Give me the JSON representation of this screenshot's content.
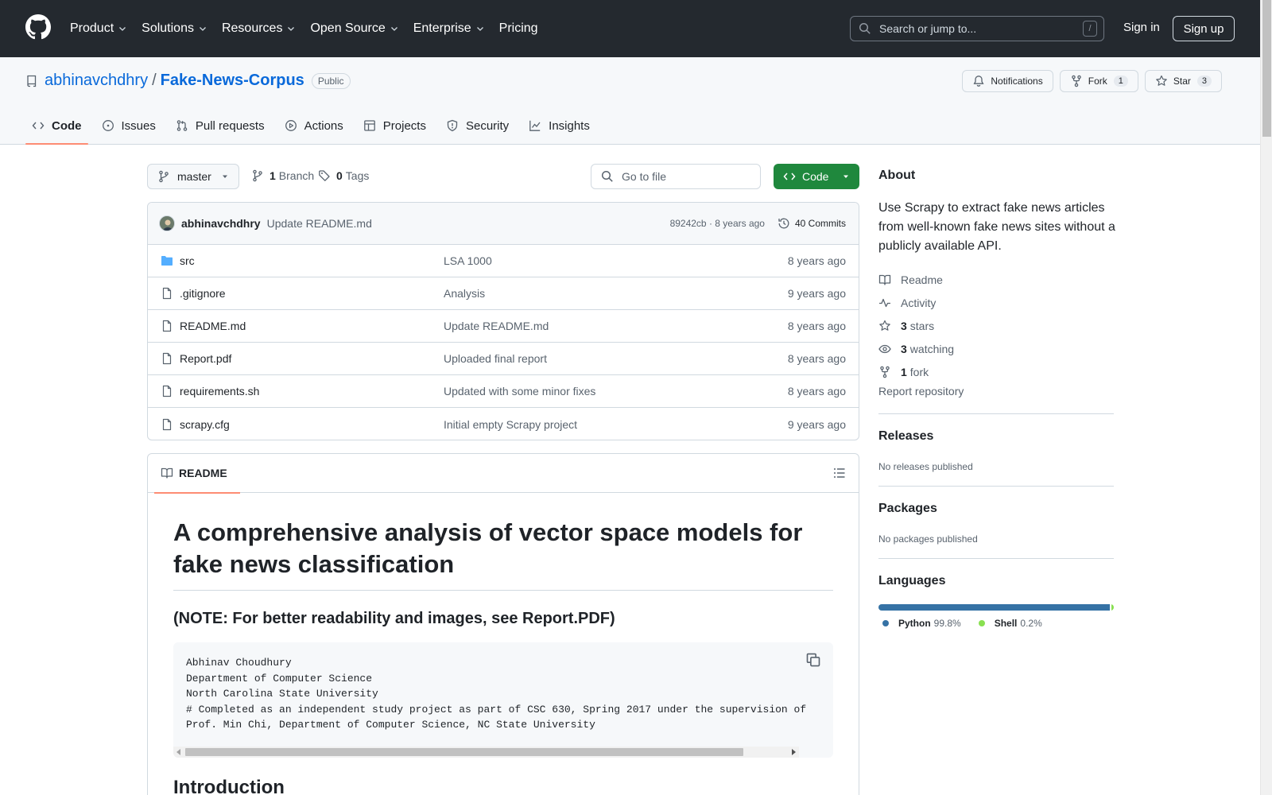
{
  "header": {
    "nav": [
      {
        "label": "Product"
      },
      {
        "label": "Solutions"
      },
      {
        "label": "Resources"
      },
      {
        "label": "Open Source"
      },
      {
        "label": "Enterprise"
      },
      {
        "label": "Pricing"
      }
    ],
    "search_placeholder": "Search or jump to...",
    "search_shortcut": "/",
    "sign_in": "Sign in",
    "sign_up": "Sign up"
  },
  "repo": {
    "owner": "abhinavchdhry",
    "separator": "/",
    "name": "Fake-News-Corpus",
    "visibility": "Public",
    "notifications_label": "Notifications",
    "fork_label": "Fork",
    "fork_count": "1",
    "star_label": "Star",
    "star_count": "3",
    "tabs": [
      {
        "label": "Code",
        "icon": "code-icon"
      },
      {
        "label": "Issues",
        "icon": "issue-icon"
      },
      {
        "label": "Pull requests",
        "icon": "pull-request-icon"
      },
      {
        "label": "Actions",
        "icon": "play-icon"
      },
      {
        "label": "Projects",
        "icon": "table-icon"
      },
      {
        "label": "Security",
        "icon": "shield-icon"
      },
      {
        "label": "Insights",
        "icon": "graph-icon"
      }
    ]
  },
  "toolbar": {
    "branch": "master",
    "branch_count": "1",
    "branch_label": "Branch",
    "tag_count": "0",
    "tag_label": "Tags",
    "goto_placeholder": "Go to file",
    "code_button": "Code"
  },
  "latest_commit": {
    "author": "abhinavchdhry",
    "message": "Update README.md",
    "meta": "89242cb · 8 years ago",
    "commits_label": "40 Commits"
  },
  "files": [
    {
      "name": "src",
      "type": "folder",
      "message": "LSA 1000",
      "date": "8 years ago"
    },
    {
      "name": ".gitignore",
      "type": "file",
      "message": "Analysis",
      "date": "9 years ago"
    },
    {
      "name": "README.md",
      "type": "file",
      "message": "Update README.md",
      "date": "8 years ago"
    },
    {
      "name": "Report.pdf",
      "type": "file",
      "message": "Uploaded final report",
      "date": "8 years ago"
    },
    {
      "name": "requirements.sh",
      "type": "file",
      "message": "Updated with some minor fixes",
      "date": "8 years ago"
    },
    {
      "name": "scrapy.cfg",
      "type": "file",
      "message": "Initial empty Scrapy project",
      "date": "9 years ago"
    }
  ],
  "readme": {
    "tab_label": "README",
    "title": "A comprehensive analysis of vector space models for fake news classification",
    "note": "(NOTE: For better readability and images, see Report.PDF)",
    "code_lines": [
      "Abhinav Choudhury",
      "Department of Computer Science",
      "North Carolina State University",
      "# Completed as an independent study project as part of CSC 630, Spring 2017 under the supervision of",
      "Prof. Min Chi, Department of Computer Science, NC State University"
    ],
    "next_heading": "Introduction"
  },
  "about": {
    "title": "About",
    "description": "Use Scrapy to extract fake news articles from well-known fake news sites without a publicly available API.",
    "items": [
      {
        "icon": "book-icon",
        "bold": "",
        "label": "Readme"
      },
      {
        "icon": "pulse-icon",
        "bold": "",
        "label": "Activity"
      },
      {
        "icon": "star-icon",
        "bold": "3",
        "label": "stars"
      },
      {
        "icon": "eye-icon",
        "bold": "3",
        "label": "watching"
      },
      {
        "icon": "fork-icon",
        "bold": "1",
        "label": "fork"
      }
    ],
    "report": "Report repository"
  },
  "releases": {
    "title": "Releases",
    "subtitle": "No releases published"
  },
  "packages": {
    "title": "Packages",
    "subtitle": "No packages published"
  },
  "languages": {
    "title": "Languages",
    "items": [
      {
        "name": "Python",
        "percent": "99.8%",
        "value": 99.8,
        "color": "#3572a5"
      },
      {
        "name": "Shell",
        "percent": "0.2%",
        "value": 0.2,
        "color": "#89e051"
      }
    ]
  }
}
